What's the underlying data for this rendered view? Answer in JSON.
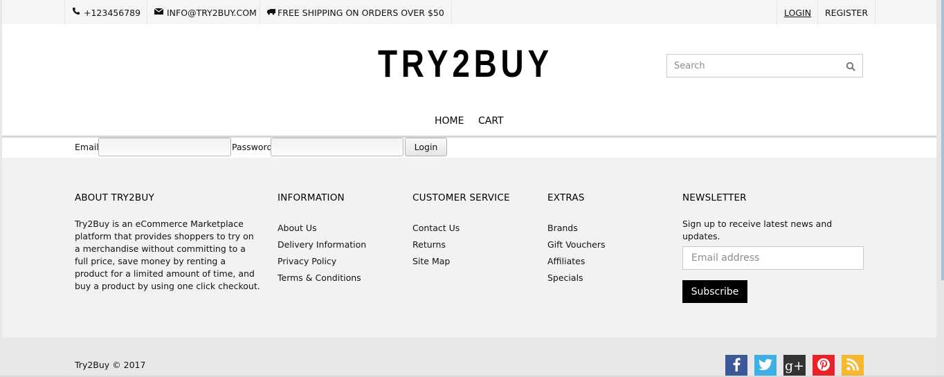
{
  "topbar": {
    "phone": {
      "icon": "phone-icon",
      "text": "+123456789"
    },
    "email": {
      "icon": "envelope-icon",
      "text": "INFO@TRY2BUY.COM"
    },
    "shipping": {
      "icon": "truck-icon",
      "text": "FREE SHIPPING ON ORDERS OVER $50"
    },
    "login": "LOGIN",
    "register": "REGISTER"
  },
  "header": {
    "logo": "TRY2BUY",
    "search": {
      "placeholder": "Search",
      "value": "",
      "icon": "search-icon"
    }
  },
  "nav": {
    "items": [
      {
        "label": "HOME"
      },
      {
        "label": "CART"
      }
    ]
  },
  "login_form": {
    "email_label": "Email",
    "email_value": "",
    "password_label": "Password",
    "password_value": "",
    "button": "Login"
  },
  "footer": {
    "about": {
      "title": "ABOUT TRY2BUY",
      "text": "Try2Buy is an eCommerce Marketplace platform that provides shoppers to try on a merchandise without committing to a full price, save money by renting a product for a limited amount of time, and buy a product by using one click checkout."
    },
    "information": {
      "title": "INFORMATION",
      "links": [
        "About Us",
        "Delivery Information",
        "Privacy Policy",
        "Terms & Conditions"
      ]
    },
    "customer_service": {
      "title": "CUSTOMER SERVICE",
      "links": [
        "Contact Us",
        "Returns",
        "Site Map"
      ]
    },
    "extras": {
      "title": "EXTRAS",
      "links": [
        "Brands",
        "Gift Vouchers",
        "Affiliates",
        "Specials"
      ]
    },
    "newsletter": {
      "title": "NEWSLETTER",
      "text": "Sign up to receive latest news and updates.",
      "placeholder": "Email address",
      "value": "",
      "button": "Subscribe"
    }
  },
  "bottom": {
    "copyright": "Try2Buy © 2017",
    "social": [
      {
        "name": "facebook",
        "glyph": "f",
        "color": "#3b5998"
      },
      {
        "name": "twitter",
        "glyph": "t",
        "color": "#3fb0e6"
      },
      {
        "name": "google-plus",
        "glyph": "g+",
        "color": "#333333"
      },
      {
        "name": "pinterest",
        "glyph": "P",
        "color": "#ec2127"
      },
      {
        "name": "rss",
        "glyph": "rss",
        "color": "#f7b82f"
      }
    ]
  }
}
